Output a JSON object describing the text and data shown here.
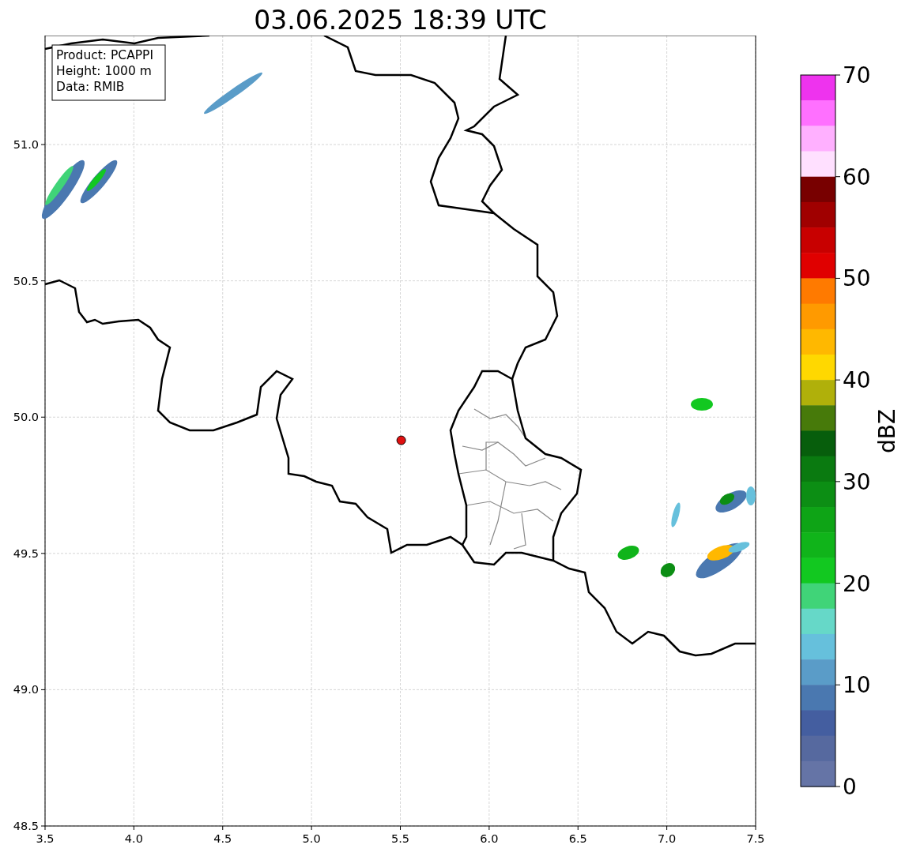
{
  "title": "03.06.2025 18:39 UTC",
  "info_box": [
    "Product: PCAPPI",
    "Height: 1000 m",
    "Data: RMIB"
  ],
  "chart_data": {
    "type": "scatter",
    "xlim": [
      3.5,
      7.5
    ],
    "ylim": [
      48.5,
      51.4
    ],
    "xticks": [
      {
        "value": 3.5,
        "label": "3.5"
      },
      {
        "value": 4,
        "label": "4.0"
      },
      {
        "value": 4.5,
        "label": "4.5"
      },
      {
        "value": 5,
        "label": "5.0"
      },
      {
        "value": 5.5,
        "label": "5.5"
      },
      {
        "value": 6,
        "label": "6.0"
      },
      {
        "value": 6.5,
        "label": "6.5"
      },
      {
        "value": 7,
        "label": "7.0"
      },
      {
        "value": 7.5,
        "label": "7.5"
      }
    ],
    "yticks": [
      {
        "value": 48.5,
        "label": "48.5"
      },
      {
        "value": 49,
        "label": "49.0"
      },
      {
        "value": 49.5,
        "label": "49.5"
      },
      {
        "value": 50,
        "label": "50.0"
      },
      {
        "value": 50.5,
        "label": "50.5"
      },
      {
        "value": 51,
        "label": "51.0"
      }
    ],
    "x": [
      5.505
    ],
    "grid": true,
    "series": [
      {
        "color": "#e01010",
        "values": [
          49.915
        ]
      }
    ]
  },
  "colorbar": {
    "label": "dBZ",
    "ticks": [
      "70",
      "60",
      "50",
      "40",
      "30",
      "20",
      "10",
      "0"
    ],
    "bands": [
      {
        "color": "#ee33ee"
      },
      {
        "color": "#ff70ff"
      },
      {
        "color": "#ffb0ff"
      },
      {
        "color": "#ffe0ff"
      },
      {
        "color": "#780000"
      },
      {
        "color": "#a00000"
      },
      {
        "color": "#c80000"
      },
      {
        "color": "#e00000"
      },
      {
        "color": "#ff7a00"
      },
      {
        "color": "#ff9a00"
      },
      {
        "color": "#ffb800"
      },
      {
        "color": "#ffd800"
      },
      {
        "color": "#b0b00a"
      },
      {
        "color": "#477a0a"
      },
      {
        "color": "#075e0c"
      },
      {
        "color": "#0a7a10"
      },
      {
        "color": "#0c8e14"
      },
      {
        "color": "#0ea416"
      },
      {
        "color": "#10b41a"
      },
      {
        "color": "#12c820"
      },
      {
        "color": "#40d478"
      },
      {
        "color": "#66d8c8"
      },
      {
        "color": "#66c0dc"
      },
      {
        "color": "#5a9cc8"
      },
      {
        "color": "#4a78b0"
      },
      {
        "color": "#445ea0"
      },
      {
        "color": "#56699f"
      },
      {
        "color": "#6574a6"
      }
    ]
  }
}
